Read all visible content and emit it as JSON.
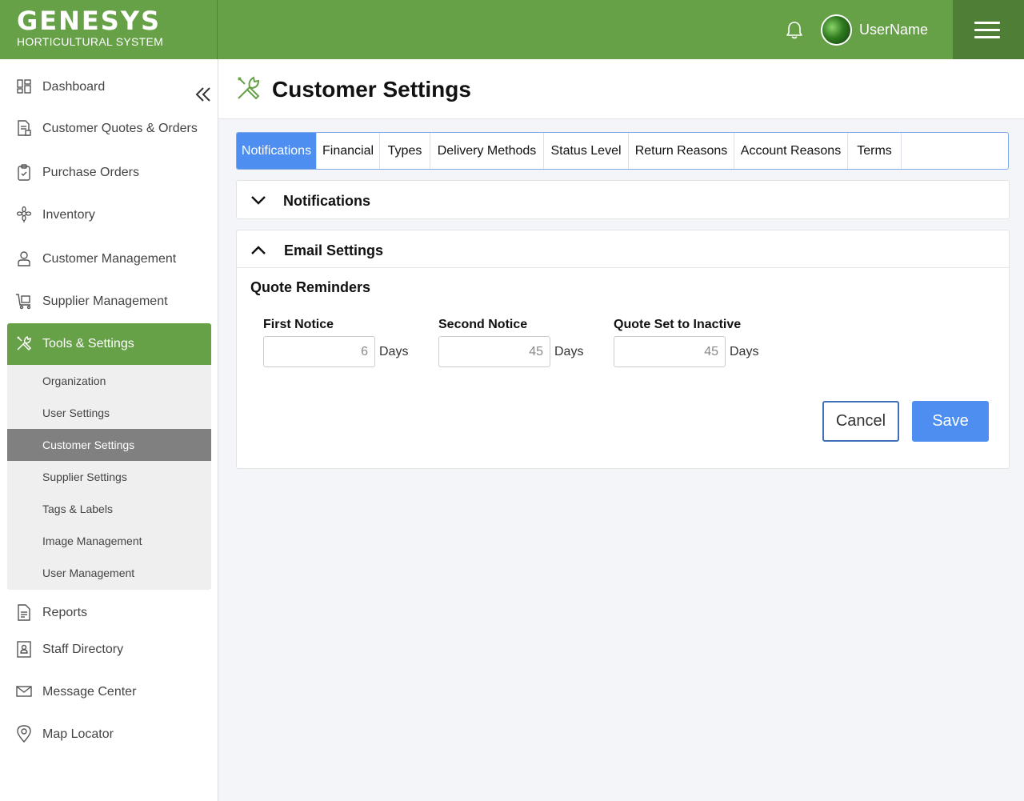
{
  "header": {
    "logo_main": "GENESYS",
    "logo_sub": "HORTICULTURAL SYSTEM",
    "username": "UserName",
    "brand_color": "#66a047"
  },
  "sidebar": {
    "items": [
      {
        "label": "Dashboard",
        "icon": "dashboard-icon"
      },
      {
        "label": "Customer Quotes & Orders",
        "icon": "document-icon"
      },
      {
        "label": "Purchase Orders",
        "icon": "clipboard-check-icon"
      },
      {
        "label": "Inventory",
        "icon": "flower-icon"
      },
      {
        "label": "Customer Management",
        "icon": "user-icon"
      },
      {
        "label": "Supplier Management",
        "icon": "cart-icon"
      },
      {
        "label": "Tools & Settings",
        "icon": "tools-icon",
        "active": true
      },
      {
        "label": "Reports",
        "icon": "report-icon"
      },
      {
        "label": "Staff Directory",
        "icon": "contact-book-icon"
      },
      {
        "label": "Message Center",
        "icon": "envelope-icon"
      },
      {
        "label": "Map Locator",
        "icon": "map-pin-icon"
      }
    ],
    "sub_items": [
      {
        "label": "Organization"
      },
      {
        "label": "User Settings"
      },
      {
        "label": "Customer Settings",
        "active": true
      },
      {
        "label": "Supplier Settings"
      },
      {
        "label": "Tags & Labels"
      },
      {
        "label": "Image Management"
      },
      {
        "label": "User Management"
      }
    ]
  },
  "page": {
    "title": "Customer Settings",
    "icon": "tools-icon"
  },
  "tabs": [
    {
      "label": "Notifications",
      "active": true
    },
    {
      "label": "Financial"
    },
    {
      "label": "Types"
    },
    {
      "label": "Delivery Methods"
    },
    {
      "label": "Status Level"
    },
    {
      "label": "Return Reasons"
    },
    {
      "label": "Account Reasons"
    },
    {
      "label": "Terms"
    }
  ],
  "panels": {
    "notifications": {
      "title": "Notifications",
      "expanded": false
    },
    "email": {
      "title": "Email Settings",
      "expanded": true,
      "section_title": "Quote Reminders",
      "fields": [
        {
          "label": "First Notice",
          "value": "6",
          "unit": "Days"
        },
        {
          "label": "Second Notice",
          "value": "45",
          "unit": "Days"
        },
        {
          "label": "Quote Set to Inactive",
          "value": "45",
          "unit": "Days"
        }
      ],
      "cancel_label": "Cancel",
      "save_label": "Save"
    }
  }
}
